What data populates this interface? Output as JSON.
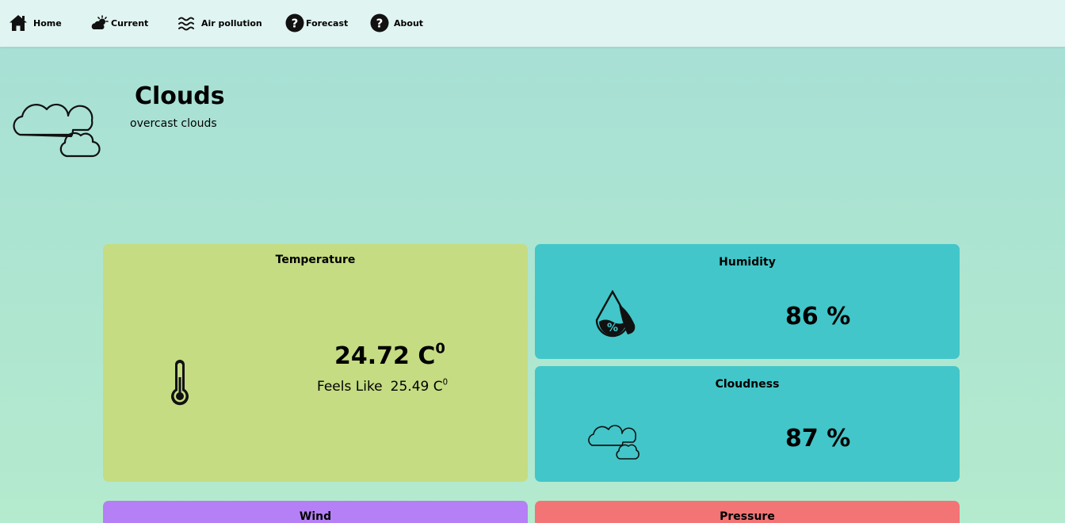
{
  "nav": {
    "home": "Home",
    "current": "Current",
    "air_pollution": "Air pollution",
    "forecast": "Forecast",
    "about": "About"
  },
  "hero": {
    "condition": "Clouds",
    "description": "overcast clouds",
    "icon": "clouds-icon"
  },
  "temperature": {
    "title": "Temperature",
    "value": "24.72 C",
    "unit_sup": "0",
    "feels_label": "Feels Like",
    "feels_value": "25.49 C",
    "feels_sup": "0",
    "icon": "thermometer-icon"
  },
  "humidity": {
    "title": "Humidity",
    "value": "86 %",
    "icon": "humidity-drop-icon"
  },
  "cloudiness": {
    "title": "Cloudness",
    "value": "87 %",
    "icon": "clouds-icon"
  },
  "wind": {
    "title": "Wind"
  },
  "pressure": {
    "title": "Pressure"
  },
  "colors": {
    "nav_bg": "#e0f4f1",
    "temperature_card": "#c5dc82",
    "humidity_card": "#42c6c9",
    "wind_card": "#b57ff5",
    "pressure_card": "#f37474"
  }
}
